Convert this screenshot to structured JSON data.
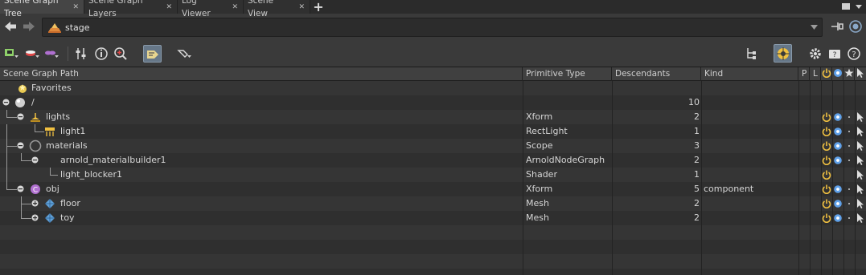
{
  "tabs": [
    {
      "label": "Scene Graph Tree",
      "active": true
    },
    {
      "label": "Scene Graph Layers",
      "active": false
    },
    {
      "label": "Log Viewer",
      "active": false
    },
    {
      "label": "Scene View",
      "active": false
    }
  ],
  "path": {
    "value": "stage"
  },
  "columns": {
    "path": "Scene Graph Path",
    "type": "Primitive Type",
    "desc": "Descendants",
    "kind": "Kind",
    "p": "P",
    "l": "L"
  },
  "rows": [
    {
      "name": "Favorites",
      "type": "",
      "desc": "",
      "kind": "",
      "icon": "favorites-icon",
      "depth": 0,
      "expander": "none",
      "flags": false
    },
    {
      "name": "/",
      "type": "",
      "desc": "10",
      "kind": "",
      "icon": "root-sphere-icon",
      "depth": 0,
      "expander": "collapse",
      "flags": false
    },
    {
      "name": "lights",
      "type": "Xform",
      "desc": "2",
      "kind": "",
      "icon": "lights-xform-icon",
      "depth": 1,
      "expander": "collapse",
      "flags": true,
      "vis": true
    },
    {
      "name": "light1",
      "type": "RectLight",
      "desc": "1",
      "kind": "",
      "icon": "rect-light-icon",
      "depth": 2,
      "expander": "none",
      "flags": true,
      "vis": true
    },
    {
      "name": "materials",
      "type": "Scope",
      "desc": "3",
      "kind": "",
      "icon": "scope-icon",
      "depth": 1,
      "expander": "collapse",
      "flags": true,
      "vis": true
    },
    {
      "name": "arnold_materialbuilder1",
      "type": "ArnoldNodeGraph",
      "desc": "2",
      "kind": "",
      "icon": "",
      "depth": 2,
      "expander": "collapse",
      "flags": true,
      "vis": true
    },
    {
      "name": "light_blocker1",
      "type": "Shader",
      "desc": "1",
      "kind": "",
      "icon": "",
      "depth": 2,
      "expander": "none",
      "flags": true,
      "vis": false
    },
    {
      "name": "obj",
      "type": "Xform",
      "desc": "5",
      "kind": "component",
      "icon": "component-icon",
      "depth": 1,
      "expander": "collapse",
      "flags": true,
      "vis": true
    },
    {
      "name": "floor",
      "type": "Mesh",
      "desc": "2",
      "kind": "",
      "icon": "mesh-icon",
      "depth": 2,
      "expander": "expand",
      "flags": true,
      "vis": true
    },
    {
      "name": "toy",
      "type": "Mesh",
      "desc": "2",
      "kind": "",
      "icon": "mesh-icon",
      "depth": 2,
      "expander": "expand",
      "flags": true,
      "vis": true
    }
  ],
  "colors": {
    "accent": "#f0c040",
    "eye": "#5fa0e8",
    "selected_tool": "#667788"
  }
}
